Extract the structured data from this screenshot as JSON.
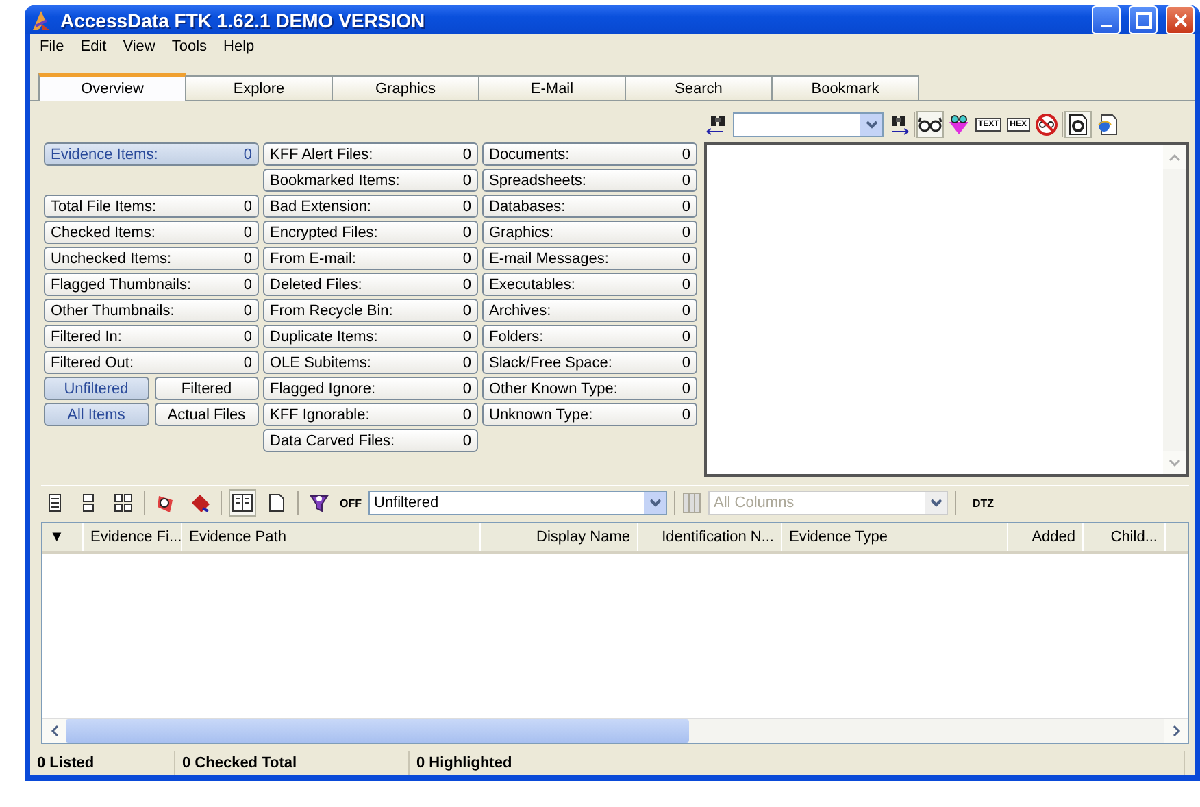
{
  "window": {
    "title": "AccessData FTK 1.62.1 DEMO VERSION"
  },
  "menu": [
    "File",
    "Edit",
    "View",
    "Tools",
    "Help"
  ],
  "tabs": [
    {
      "label": "Overview",
      "selected": true
    },
    {
      "label": "Explore",
      "selected": false
    },
    {
      "label": "Graphics",
      "selected": false
    },
    {
      "label": "E-Mail",
      "selected": false
    },
    {
      "label": "Search",
      "selected": false
    },
    {
      "label": "Bookmark",
      "selected": false
    }
  ],
  "counter_columns": [
    [
      {
        "kind": "counter",
        "label": "Evidence Items:",
        "value": "0",
        "selected": true
      },
      {
        "kind": "spacer"
      },
      {
        "kind": "counter",
        "label": "Total File Items:",
        "value": "0",
        "selected": false
      },
      {
        "kind": "counter",
        "label": "Checked Items:",
        "value": "0",
        "selected": false
      },
      {
        "kind": "counter",
        "label": "Unchecked Items:",
        "value": "0",
        "selected": false
      },
      {
        "kind": "counter",
        "label": "Flagged Thumbnails:",
        "value": "0",
        "selected": false
      },
      {
        "kind": "counter",
        "label": "Other Thumbnails:",
        "value": "0",
        "selected": false
      },
      {
        "kind": "counter",
        "label": "Filtered In:",
        "value": "0",
        "selected": false
      },
      {
        "kind": "counter",
        "label": "Filtered Out:",
        "value": "0",
        "selected": false
      },
      {
        "kind": "toggle_pair",
        "options": [
          {
            "label": "Unfiltered",
            "selected": true
          },
          {
            "label": "Filtered",
            "selected": false
          }
        ]
      },
      {
        "kind": "toggle_pair",
        "options": [
          {
            "label": "All Items",
            "selected": true
          },
          {
            "label": "Actual Files",
            "selected": false
          }
        ]
      }
    ],
    [
      {
        "kind": "counter",
        "label": "KFF Alert Files:",
        "value": "0",
        "selected": false
      },
      {
        "kind": "counter",
        "label": "Bookmarked Items:",
        "value": "0",
        "selected": false
      },
      {
        "kind": "counter",
        "label": "Bad Extension:",
        "value": "0",
        "selected": false
      },
      {
        "kind": "counter",
        "label": "Encrypted Files:",
        "value": "0",
        "selected": false
      },
      {
        "kind": "counter",
        "label": "From E-mail:",
        "value": "0",
        "selected": false
      },
      {
        "kind": "counter",
        "label": "Deleted Files:",
        "value": "0",
        "selected": false
      },
      {
        "kind": "counter",
        "label": "From Recycle Bin:",
        "value": "0",
        "selected": false
      },
      {
        "kind": "counter",
        "label": "Duplicate Items:",
        "value": "0",
        "selected": false
      },
      {
        "kind": "counter",
        "label": "OLE Subitems:",
        "value": "0",
        "selected": false
      },
      {
        "kind": "counter",
        "label": "Flagged Ignore:",
        "value": "0",
        "selected": false
      },
      {
        "kind": "counter",
        "label": "KFF Ignorable:",
        "value": "0",
        "selected": false
      },
      {
        "kind": "counter",
        "label": "Data Carved Files:",
        "value": "0",
        "selected": false
      }
    ],
    [
      {
        "kind": "counter",
        "label": "Documents:",
        "value": "0",
        "selected": false
      },
      {
        "kind": "counter",
        "label": "Spreadsheets:",
        "value": "0",
        "selected": false
      },
      {
        "kind": "counter",
        "label": "Databases:",
        "value": "0",
        "selected": false
      },
      {
        "kind": "counter",
        "label": "Graphics:",
        "value": "0",
        "selected": false
      },
      {
        "kind": "counter",
        "label": "E-mail Messages:",
        "value": "0",
        "selected": false
      },
      {
        "kind": "counter",
        "label": "Executables:",
        "value": "0",
        "selected": false
      },
      {
        "kind": "counter",
        "label": "Archives:",
        "value": "0",
        "selected": false
      },
      {
        "kind": "counter",
        "label": "Folders:",
        "value": "0",
        "selected": false
      },
      {
        "kind": "counter",
        "label": "Slack/Free Space:",
        "value": "0",
        "selected": false
      },
      {
        "kind": "counter",
        "label": "Other Known Type:",
        "value": "0",
        "selected": false
      },
      {
        "kind": "counter",
        "label": "Unknown Type:",
        "value": "0",
        "selected": false
      }
    ]
  ],
  "viewer": {
    "tools": [
      {
        "kind": "text",
        "label": "TEXT"
      },
      {
        "kind": "text",
        "label": "HEX"
      }
    ]
  },
  "file_toolbar": {
    "filter_state": "OFF",
    "filter": "Unfiltered",
    "columns": "All Columns",
    "dtz": "DTZ"
  },
  "table": {
    "columns": [
      "▼",
      "Evidence Fi...",
      "Evidence Path",
      "Display Name",
      "Identification N...",
      "Evidence Type",
      "Added",
      "Child..."
    ]
  },
  "status_bar": [
    "0 Listed",
    "0 Checked Total",
    "0 Highlighted"
  ]
}
